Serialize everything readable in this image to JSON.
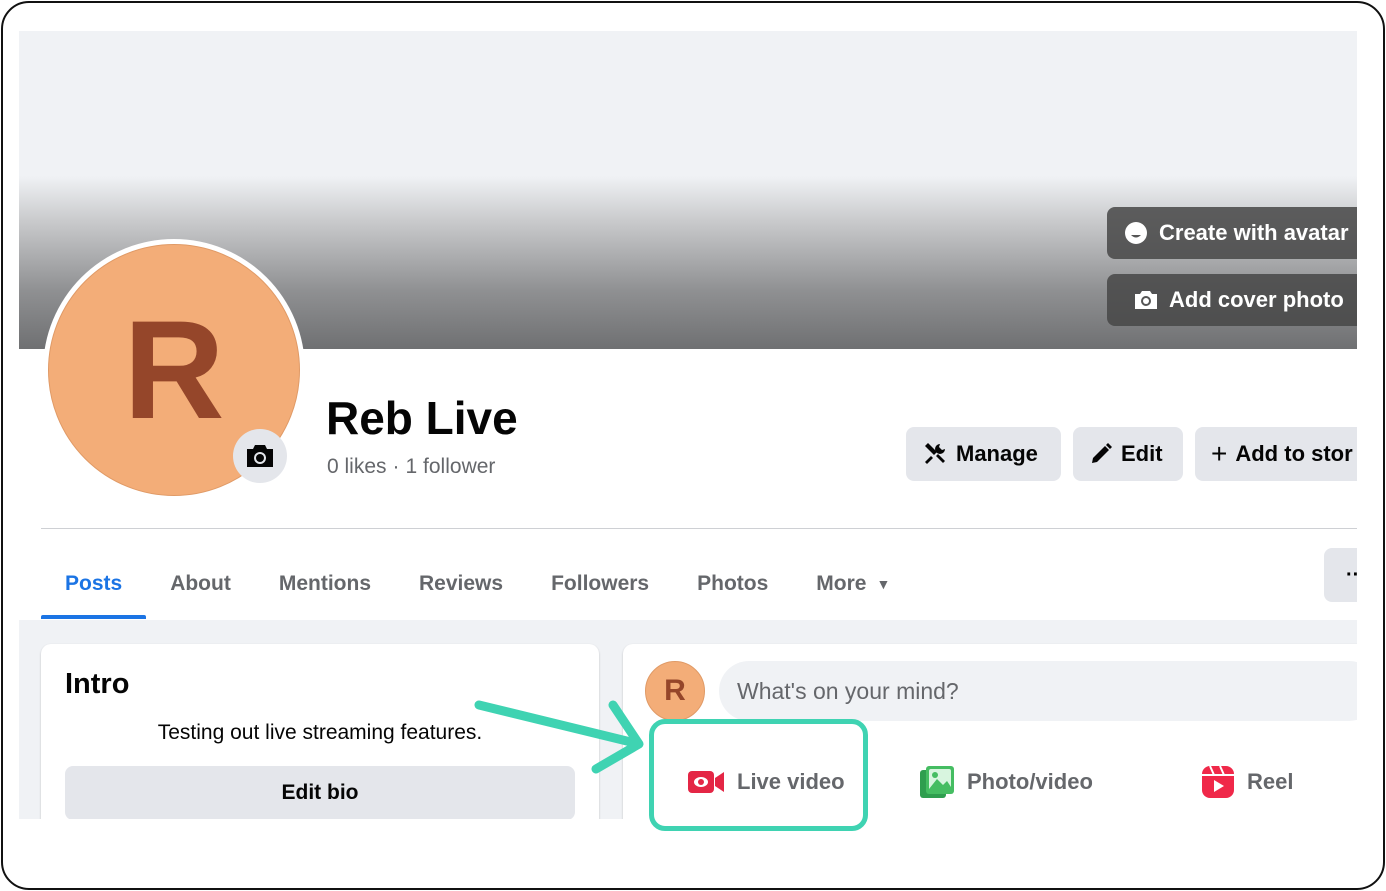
{
  "cover": {
    "create_avatar_label": "Create with avatar",
    "add_cover_label": "Add cover photo"
  },
  "profile": {
    "initial": "R",
    "name": "Reb Live",
    "likes": "0 likes",
    "followers": "1 follower",
    "separator": "·"
  },
  "actions": {
    "manage_label": "Manage",
    "edit_label": "Edit",
    "add_story_label": "Add to stor"
  },
  "tabs": {
    "items": [
      {
        "label": "Posts",
        "active": true
      },
      {
        "label": "About"
      },
      {
        "label": "Mentions"
      },
      {
        "label": "Reviews"
      },
      {
        "label": "Followers"
      },
      {
        "label": "Photos"
      },
      {
        "label": "More"
      }
    ],
    "overflow_label": "··"
  },
  "intro": {
    "title": "Intro",
    "bio": "Testing out live streaming features.",
    "edit_bio_label": "Edit bio"
  },
  "composer": {
    "avatar_initial": "R",
    "placeholder": "What's on your mind?",
    "live_label": "Live video",
    "photo_label": "Photo/video",
    "reel_label": "Reel"
  },
  "colors": {
    "accent": "#1b74e4",
    "annotation": "#3fd3b2",
    "avatar_bg": "#f3ad78",
    "avatar_text": "#95462a",
    "live_red": "#e42645",
    "photo_green": "#45bd62",
    "reel_red": "#f02849"
  }
}
